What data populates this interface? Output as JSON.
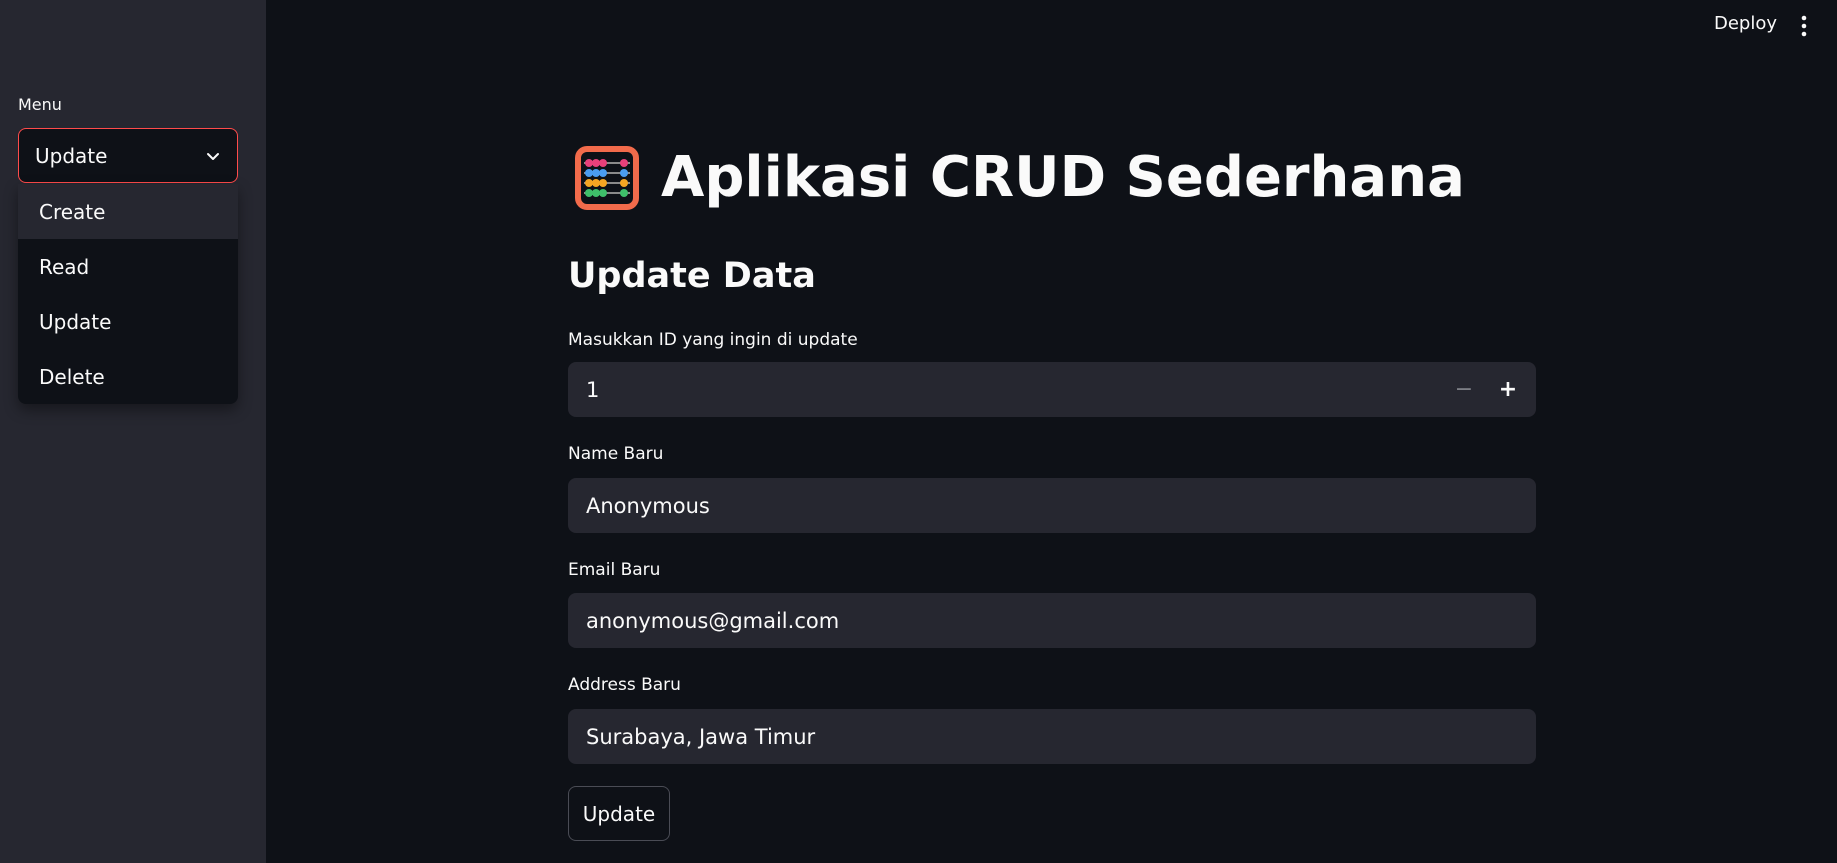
{
  "header": {
    "deploy_label": "Deploy",
    "more_icon": "kebab-menu-icon"
  },
  "sidebar": {
    "menu_label": "Menu",
    "select": {
      "value": "Update",
      "icon": "chevron-down-icon",
      "accent_color": "#ff4b4b"
    },
    "options": [
      {
        "label": "Create"
      },
      {
        "label": "Read"
      },
      {
        "label": "Update"
      },
      {
        "label": "Delete"
      }
    ]
  },
  "main": {
    "title_icon": "abacus-icon",
    "title": "Aplikasi CRUD Sederhana",
    "subheader": "Update Data",
    "fields": {
      "id": {
        "label": "Masukkan ID yang ingin di update",
        "value": "1",
        "minus": "−",
        "plus": "+"
      },
      "name": {
        "label": "Name Baru",
        "value": "Anonymous"
      },
      "email": {
        "label": "Email Baru",
        "value": "anonymous@gmail.com"
      },
      "address": {
        "label": "Address Baru",
        "value": "Surabaya, Jawa Timur"
      }
    },
    "submit_label": "Update"
  },
  "colors": {
    "background": "#0e1117",
    "sidebar": "#262730",
    "input_bg": "#262730",
    "accent": "#ff4b4b"
  }
}
